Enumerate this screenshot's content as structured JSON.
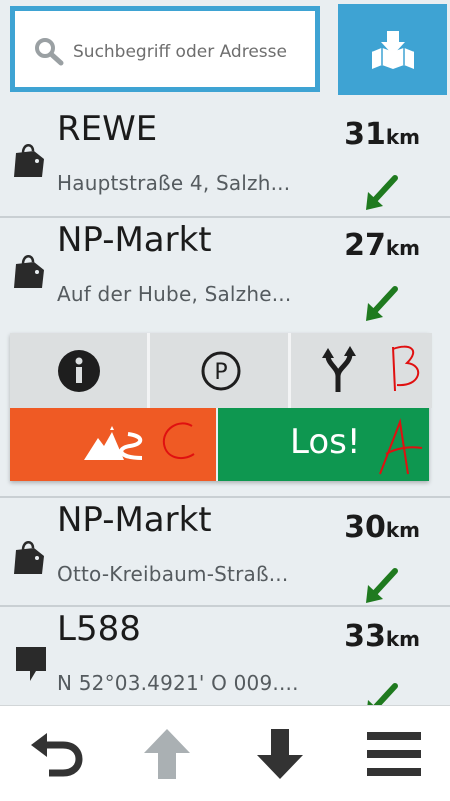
{
  "search": {
    "placeholder": "Suchbegriff oder Adresse"
  },
  "header": {
    "map_icon": "map-download-icon"
  },
  "results": [
    {
      "name": "REWE",
      "address": "Hauptstraße 4, Salzh...",
      "distance": "31",
      "unit": "km",
      "category_icon": "shopping-bag-icon",
      "direction": "southwest"
    },
    {
      "name": "NP-Markt",
      "address": "Auf der Hube, Salzhe...",
      "distance": "27",
      "unit": "km",
      "category_icon": "shopping-bag-icon",
      "direction": "southwest"
    },
    {
      "name": "NP-Markt",
      "address": "Otto-Kreibaum-Straß...",
      "distance": "30",
      "unit": "km",
      "category_icon": "shopping-bag-icon",
      "direction": "southwest"
    },
    {
      "name": "L588",
      "address": "N 52°03.4921' O 009....",
      "distance": "33",
      "unit": "km",
      "category_icon": "map-pin-icon",
      "direction": "southwest"
    }
  ],
  "actions": {
    "info_icon": "info-icon",
    "parking_icon": "parking-icon",
    "fork_icon": "route-fork-icon",
    "route_icon": "mountain-route-icon",
    "go_label": "Los!",
    "annotations": {
      "fork": "B",
      "route": "C",
      "go": "A"
    }
  },
  "bottom_nav": [
    "back-icon",
    "arrow-up-icon",
    "arrow-down-icon",
    "menu-icon"
  ],
  "colors": {
    "accent_blue": "#3ea3d3",
    "orange": "#ef5a24",
    "green": "#0e9750",
    "arrow_green": "#1f7a1f",
    "annotation_red": "#e01010"
  }
}
